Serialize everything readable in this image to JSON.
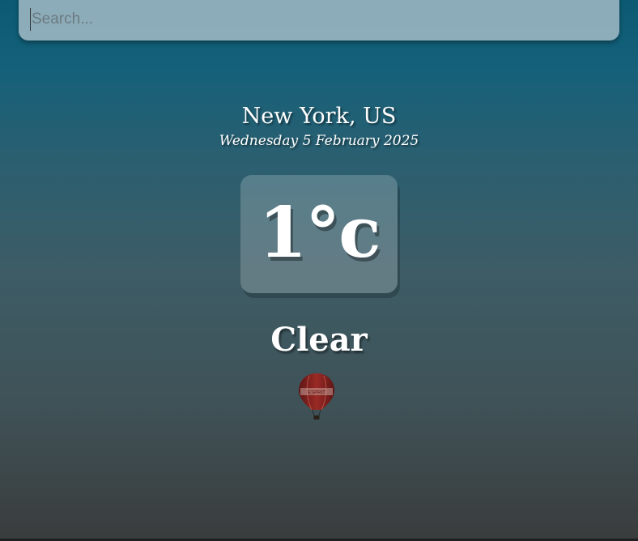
{
  "search": {
    "placeholder": "Search...",
    "value": ""
  },
  "weather": {
    "location": "New York, US",
    "date": "Wednesday 5 February 2025",
    "temperature": "1°c",
    "condition": "Clear"
  },
  "balloon_text": "ESPRIT",
  "colors": {
    "background_top": "#0b5a73",
    "background_bottom": "#3a3c3d",
    "text": "#ffffff",
    "balloon": "#8b1e1e"
  },
  "icons": {
    "balloon": "hot-air-balloon-image"
  }
}
